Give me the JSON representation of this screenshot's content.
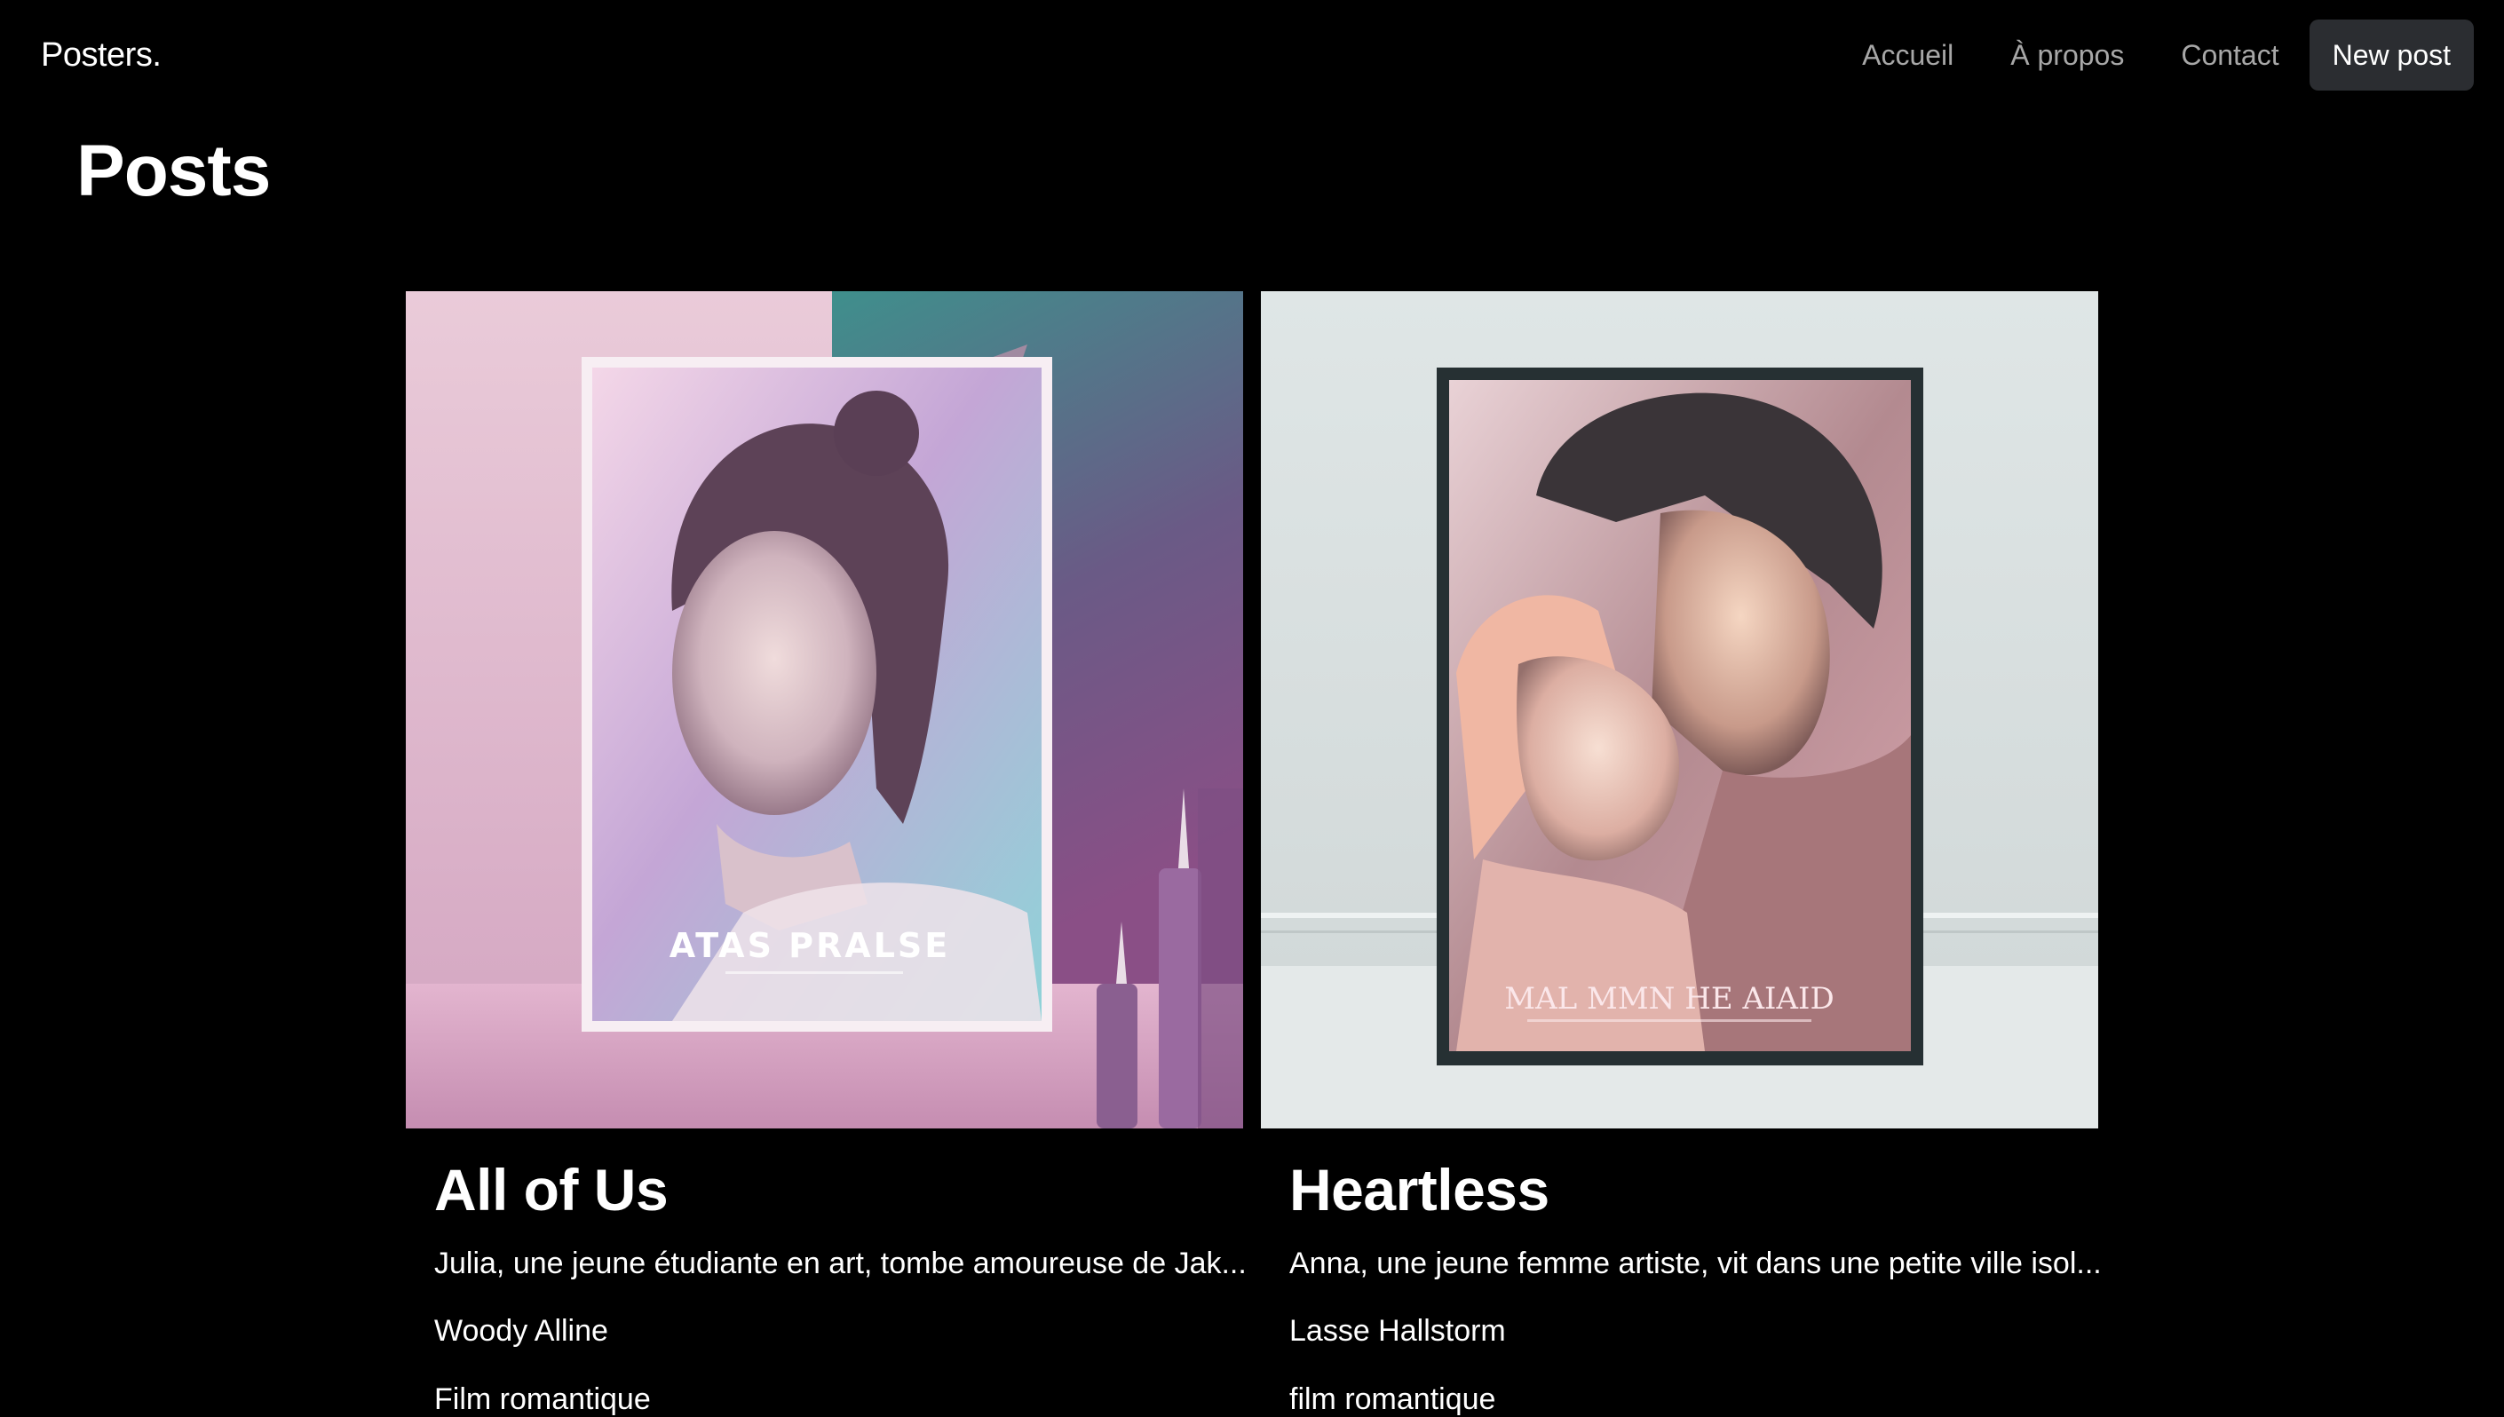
{
  "navbar": {
    "brand": "Posters.",
    "links": [
      "Accueil",
      "À propos",
      "Contact"
    ],
    "new_post_label": "New post"
  },
  "page": {
    "title": "Posts"
  },
  "posts": [
    {
      "title": "All of Us",
      "description": "Julia, une jeune étudiante en art, tombe amoureuse de Jak...",
      "author": "Woody Alline",
      "genre": "Film romantique",
      "poster_text": "ATAS PRALSE"
    },
    {
      "title": "Heartless",
      "description": "Anna, une jeune femme artiste, vit dans une petite ville isol...",
      "author": "Lasse Hallstorm",
      "genre": "film romantique",
      "poster_text": "MAL MMN HE AIAID"
    }
  ]
}
